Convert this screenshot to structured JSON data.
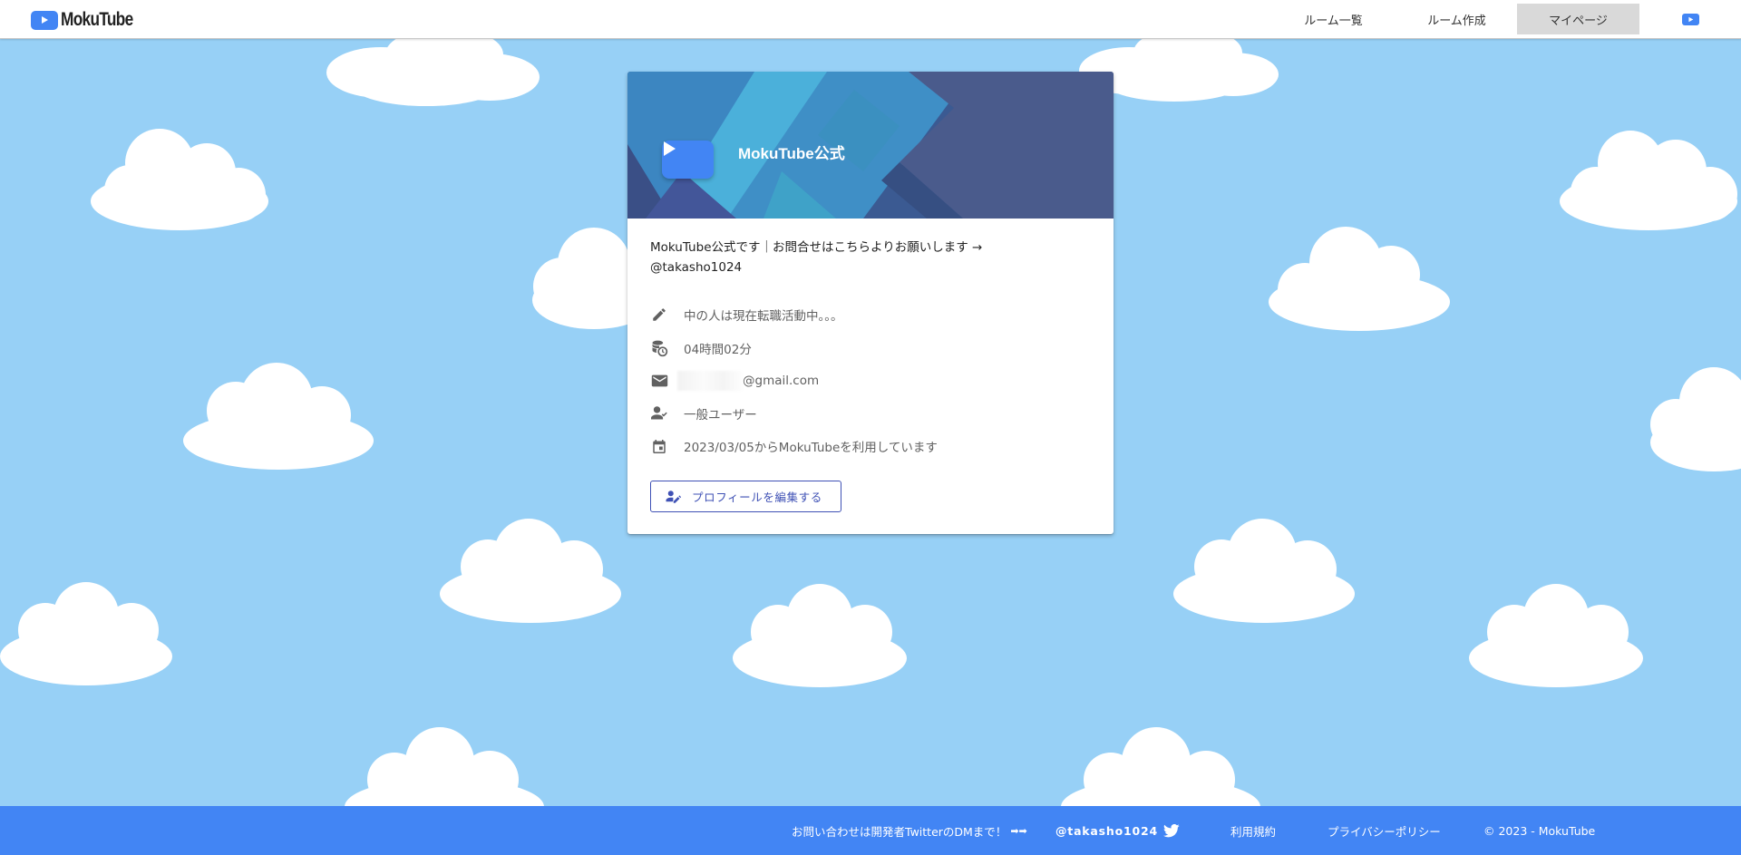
{
  "app": {
    "logo_text": "MokuTube"
  },
  "nav": {
    "items": [
      {
        "label": "ルーム一覧"
      },
      {
        "label": "ルーム作成"
      },
      {
        "label": "マイページ",
        "active": true
      }
    ]
  },
  "profile": {
    "name": "MokuTube公式",
    "bio_line1": "MokuTube公式です｜お問合せはこちらよりお願いします →",
    "bio_line2": "@takasho1024",
    "status": "中の人は現在転職活動中。。。",
    "total_time": "04時間02分",
    "email_suffix": "@gmail.com",
    "role": "一般ユーザー",
    "since": "2023/03/05からMokuTubeを利用しています",
    "edit_button_label": "プロフィールを編集する",
    "icons": [
      "pencil-icon",
      "database-clock-icon",
      "mail-icon",
      "person-icon",
      "calendar-icon",
      "account-edit-icon"
    ]
  },
  "footer": {
    "contact_text": "お問い合わせは開発者TwitterのDMまで！",
    "arrows": "➡➡",
    "twitter_handle": "@takasho1024",
    "terms": "利用規約",
    "privacy": "プライバシーポリシー",
    "copyright": "© 2023 - MokuTube"
  },
  "colors": {
    "sky": "#97d0f6",
    "brand_blue": "#4285f4",
    "indigo": "#3f51b5",
    "nav_active": "#d9d9d9"
  }
}
